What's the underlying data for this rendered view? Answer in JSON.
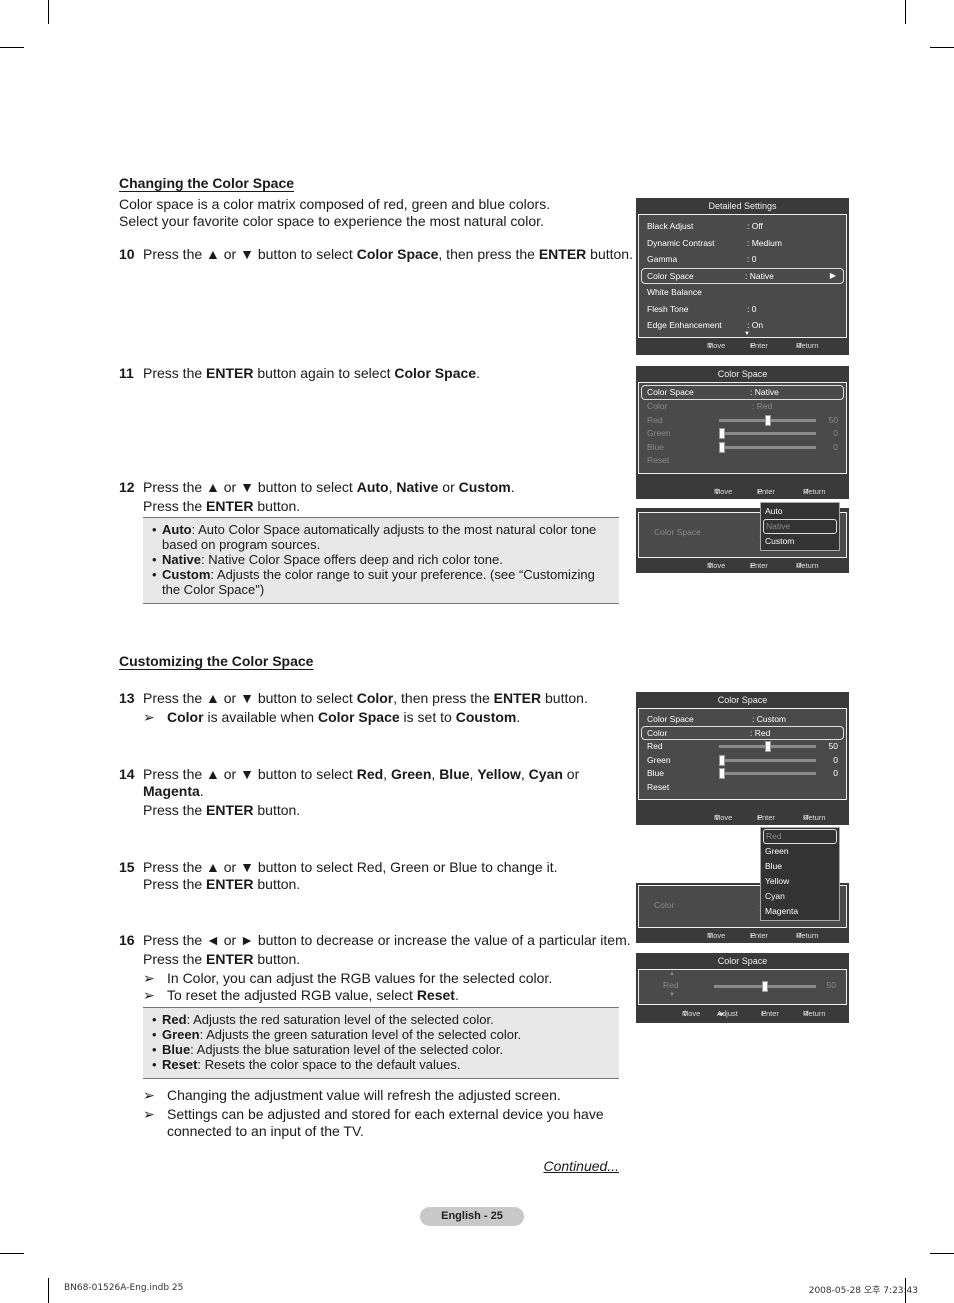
{
  "section1": {
    "heading": "Changing the Color Space",
    "intro_line1": "Color space is a color matrix composed of red, green and blue colors.",
    "intro_line2": "Select your favorite color space to experience the most natural color."
  },
  "steps": {
    "s10": {
      "num": "10",
      "t1": "Press the ▲ or ▼ button to select ",
      "b1": "Color Space",
      "t2": ", then press the ",
      "b2": "ENTER",
      "t3": " button."
    },
    "s11": {
      "num": "11",
      "t1": "Press the ",
      "b1": "ENTER",
      "t2": " button again to select ",
      "b2": "Color Space",
      "t3": "."
    },
    "s12": {
      "num": "12",
      "t1": "Press the ▲ or ▼ button to select ",
      "b1": "Auto",
      "t2": ", ",
      "b2": "Native",
      "t3": " or ",
      "b3": "Custom",
      "t4": ".",
      "l2a": "Press the ",
      "l2b": "ENTER",
      "l2c": " button."
    },
    "s13": {
      "num": "13",
      "t1": "Press the ▲ or ▼ button to select ",
      "b1": "Color",
      "t2": ", then press the ",
      "b2": "ENTER",
      "t3": " button.",
      "note": {
        "arrow": "➢",
        "b1": "Color",
        "t1": " is available when ",
        "b2": "Color Space",
        "t2": " is set to ",
        "b3": "Coustom",
        "t3": "."
      }
    },
    "s14": {
      "num": "14",
      "t1": "Press the ▲ or ▼ button to select ",
      "b1": "Red",
      "c1": ", ",
      "b2": "Green",
      "c2": ", ",
      "b3": "Blue",
      "c3": ", ",
      "b4": "Yellow",
      "c4": ", ",
      "b5": "Cyan",
      "c5": " or",
      "b6": "Magenta",
      "c6": ".",
      "l3a": "Press the ",
      "l3b": "ENTER",
      "l3c": " button."
    },
    "s15": {
      "num": "15",
      "t1": "Press the ▲ or ▼ button to select Red, Green or Blue to change it.",
      "l2a": "Press the ",
      "l2b": "ENTER",
      "l2c": " button."
    },
    "s16": {
      "num": "16",
      "t1": "Press the ◄ or ► button to decrease or increase the value of a particular item.",
      "l2a": "Press the ",
      "l2b": "ENTER",
      "l2c": " button.",
      "note1": {
        "arrow": "➢",
        "text": "In Color, you can adjust the RGB values for the selected color."
      },
      "note2": {
        "arrow": "➢",
        "t1": "To reset the adjusted RGB value, select ",
        "b1": "Reset",
        "t2": "."
      }
    }
  },
  "box1": [
    {
      "bullet": "•",
      "term": "Auto",
      "text": ": Auto Color Space automatically adjusts to the most natural color tone based on program sources."
    },
    {
      "bullet": "•",
      "term": "Native",
      "text": ": Native Color Space offers deep and rich color tone."
    },
    {
      "bullet": "•",
      "term": "Custom",
      "text": ": Adjusts the color range to suit your preference. (see “Customizing the Color Space\")"
    }
  ],
  "section2": {
    "heading": "Customizing the Color Space"
  },
  "box2": [
    {
      "bullet": "•",
      "term": "Red",
      "text": ": Adjusts the red saturation level of the selected color."
    },
    {
      "bullet": "•",
      "term": "Green",
      "text": ": Adjusts the green saturation level of the selected color."
    },
    {
      "bullet": "•",
      "term": "Blue",
      "text": ": Adjusts the blue saturation level of the selected color."
    },
    {
      "bullet": "•",
      "term": "Reset",
      "text": ": Resets the color space to the default values."
    }
  ],
  "end_notes": [
    {
      "arrow": "➢",
      "text": "Changing the adjustment value will refresh the adjusted screen."
    },
    {
      "arrow": "➢",
      "text": "Settings can be adjusted and stored for each external device you have connected to an input of the TV."
    }
  ],
  "continued": "Continued...",
  "osd_footer": {
    "move_icon": "⇕",
    "move": "Move",
    "enter_icon": "↵",
    "enter": "Enter",
    "return_icon": "↺",
    "return": "Return",
    "adjust_icon": "◂▸",
    "adjust": "Adjust"
  },
  "osd1": {
    "title": "Detailed Settings",
    "rows": [
      {
        "label": "Black Adjust",
        "value": ": Off"
      },
      {
        "label": "Dynamic Contrast",
        "value": ": Medium"
      },
      {
        "label": "Gamma",
        "value": ": 0"
      },
      {
        "label": "Color Space",
        "value": ": Native",
        "arrow": "▶"
      },
      {
        "label": "White Balance",
        "value": ""
      },
      {
        "label": "Flesh Tone",
        "value": ": 0"
      },
      {
        "label": "Edge Enhancement",
        "value": ": On"
      }
    ],
    "more_icon": "▼"
  },
  "osd2": {
    "title": "Color Space",
    "rows": [
      {
        "label": "Color Space",
        "value": ": Native"
      },
      {
        "label": "Color",
        "value": ": Red"
      },
      {
        "label": "Red",
        "value": "50",
        "level": 0.5
      },
      {
        "label": "Green",
        "value": "0",
        "level": 0
      },
      {
        "label": "Blue",
        "value": "0",
        "level": 0
      },
      {
        "label": "Reset",
        "value": ""
      }
    ]
  },
  "osd3": {
    "label": "Color Space",
    "colon": ":",
    "options": [
      "Auto",
      "Native",
      "Custom"
    ],
    "selected": "Native"
  },
  "osd4": {
    "title": "Color Space",
    "rows": [
      {
        "label": "Color Space",
        "value": ": Custom"
      },
      {
        "label": "Color",
        "value": ": Red"
      },
      {
        "label": "Red",
        "value": "50",
        "level": 0.5
      },
      {
        "label": "Green",
        "value": "0",
        "level": 0
      },
      {
        "label": "Blue",
        "value": "0",
        "level": 0
      },
      {
        "label": "Reset",
        "value": ""
      }
    ]
  },
  "osd5": {
    "label": "Color",
    "colon": ":",
    "options": [
      "Red",
      "Green",
      "Blue",
      "Yellow",
      "Cyan",
      "Magenta"
    ],
    "selected": "Red"
  },
  "osd6": {
    "title": "Color Space",
    "label": "Red",
    "value": "50",
    "level": 0.5,
    "up_icon": "▲",
    "down_icon": "▼"
  },
  "page_label": "English - 25",
  "footer": {
    "file": "BN68-01526A-Eng.indb   25",
    "datetime": "2008-05-28   오후 7:23:43"
  }
}
